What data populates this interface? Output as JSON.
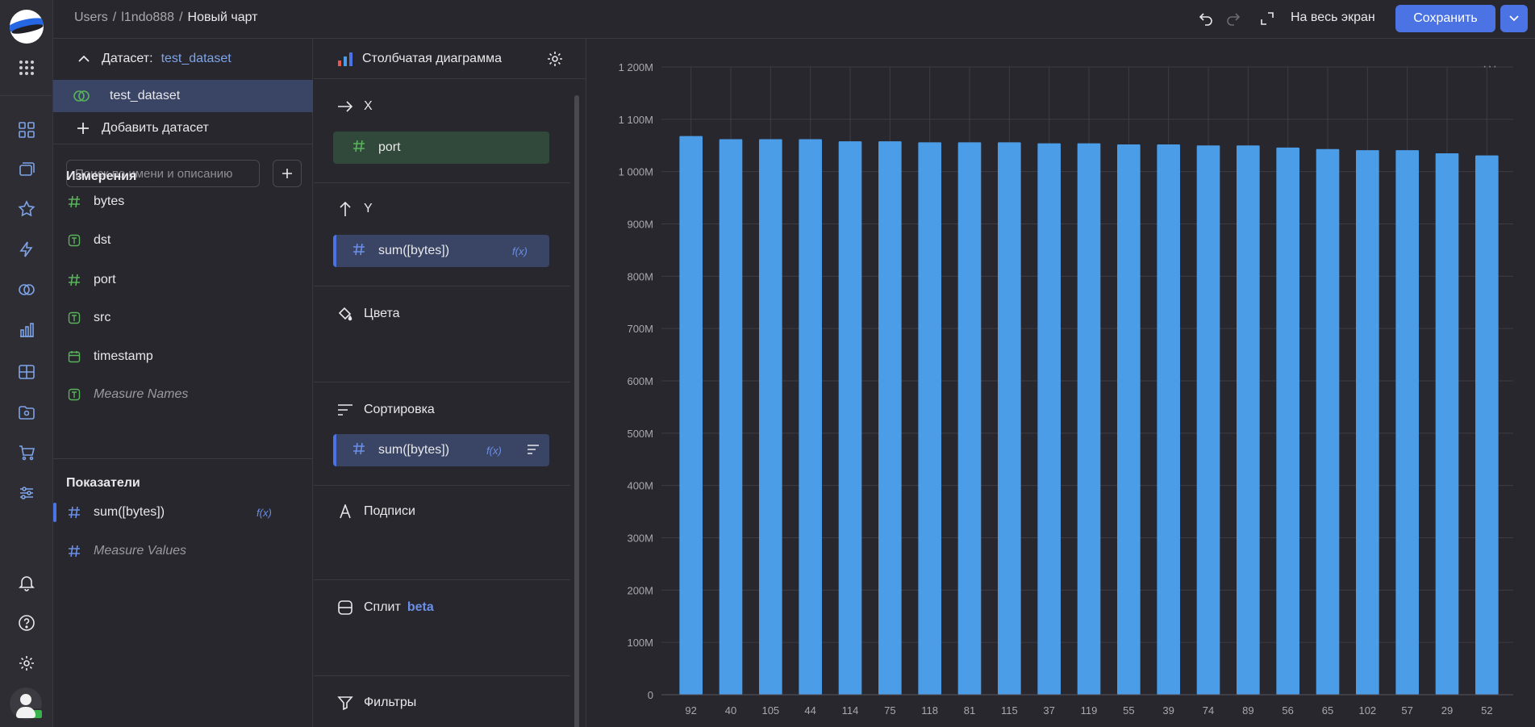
{
  "breadcrumbs": {
    "items": [
      "Users",
      "l1ndo888"
    ],
    "current": "Новый чарт"
  },
  "header": {
    "fullscreen_label": "На весь экран",
    "save_label": "Сохранить"
  },
  "dataset_panel": {
    "dataset_label": "Датасет:",
    "dataset_name": "test_dataset",
    "dataset_item": "test_dataset",
    "add_dataset": "Добавить датасет",
    "search_placeholder": "Поиск по имени и описанию",
    "dimensions_title": "Измерения",
    "dimensions": [
      {
        "name": "bytes",
        "type": "number"
      },
      {
        "name": "dst",
        "type": "text"
      },
      {
        "name": "port",
        "type": "number"
      },
      {
        "name": "src",
        "type": "text"
      },
      {
        "name": "timestamp",
        "type": "date"
      },
      {
        "name": "Measure Names",
        "type": "text"
      }
    ],
    "measures_title": "Показатели",
    "measures": [
      {
        "name": "sum([bytes])",
        "fx": "f(x)"
      },
      {
        "name": "Measure Values"
      }
    ]
  },
  "config_panel": {
    "chart_type": "Столбчатая диаграмма",
    "x_title": "X",
    "x_field": "port",
    "y_title": "Y",
    "y_field": "sum([bytes])",
    "y_fx": "f(x)",
    "colors_title": "Цвета",
    "sort_title": "Сортировка",
    "sort_field": "sum([bytes])",
    "sort_fx": "f(x)",
    "labels_title": "Подписи",
    "split_title": "Сплит",
    "split_badge": "beta",
    "filters_title": "Фильтры"
  },
  "colors": {
    "accent": "#4c73e3",
    "bar": "#4c9de8",
    "dimension": "#58b35a",
    "measure": "#6b8fe6"
  },
  "chart_data": {
    "type": "bar",
    "categories": [
      "92",
      "40",
      "105",
      "44",
      "114",
      "75",
      "118",
      "81",
      "115",
      "37",
      "119",
      "55",
      "39",
      "74",
      "89",
      "56",
      "65",
      "102",
      "57",
      "29",
      "52"
    ],
    "values": [
      1068,
      1062,
      1062,
      1062,
      1058,
      1058,
      1056,
      1056,
      1056,
      1054,
      1054,
      1052,
      1052,
      1050,
      1050,
      1046,
      1043,
      1041,
      1041,
      1035,
      1031
    ],
    "units": "M",
    "ylim": [
      0,
      1200
    ],
    "yticks": [
      "0",
      "100M",
      "200M",
      "300M",
      "400M",
      "500M",
      "600M",
      "700M",
      "800M",
      "900M",
      "1 000M",
      "1 100M",
      "1 200M"
    ],
    "grid": true,
    "title": "",
    "xlabel": "",
    "ylabel": ""
  }
}
